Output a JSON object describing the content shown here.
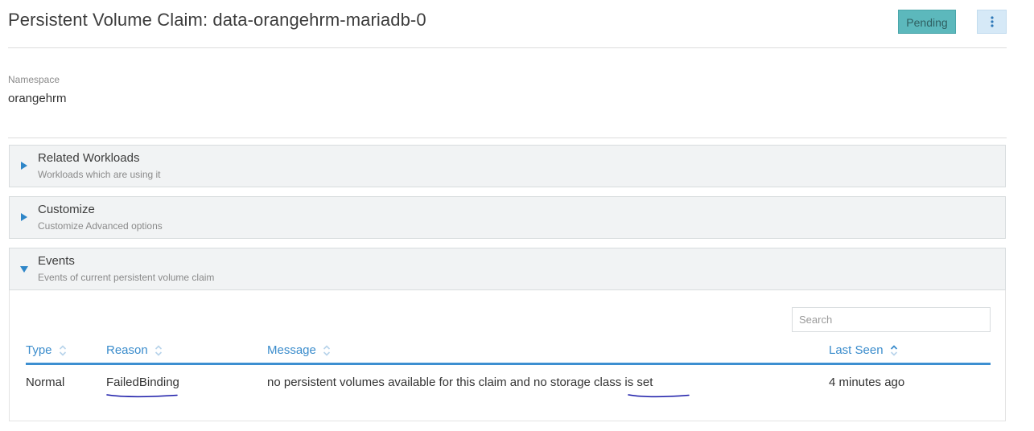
{
  "header": {
    "title": "Persistent Volume Claim: data-orangehrm-mariadb-0",
    "status": "Pending"
  },
  "namespace": {
    "label": "Namespace",
    "value": "orangehrm"
  },
  "sections": [
    {
      "title": "Related Workloads",
      "subtitle": "Workloads which are using it",
      "expanded": false
    },
    {
      "title": "Customize",
      "subtitle": "Customize Advanced options",
      "expanded": false
    },
    {
      "title": "Events",
      "subtitle": "Events of current persistent volume claim",
      "expanded": true
    }
  ],
  "events": {
    "search_placeholder": "Search",
    "columns": [
      "Type",
      "Reason",
      "Message",
      "Last Seen"
    ],
    "sorted_column": "Last Seen",
    "rows": [
      {
        "type": "Normal",
        "reason": "FailedBinding",
        "message": "no persistent volumes available for this claim and no storage class is set",
        "last_seen": "4 minutes ago"
      }
    ]
  },
  "colors": {
    "accent": "#3a8ccc",
    "status_badge": "#5cb8bc",
    "annotation_ink": "#1a1aa8"
  }
}
